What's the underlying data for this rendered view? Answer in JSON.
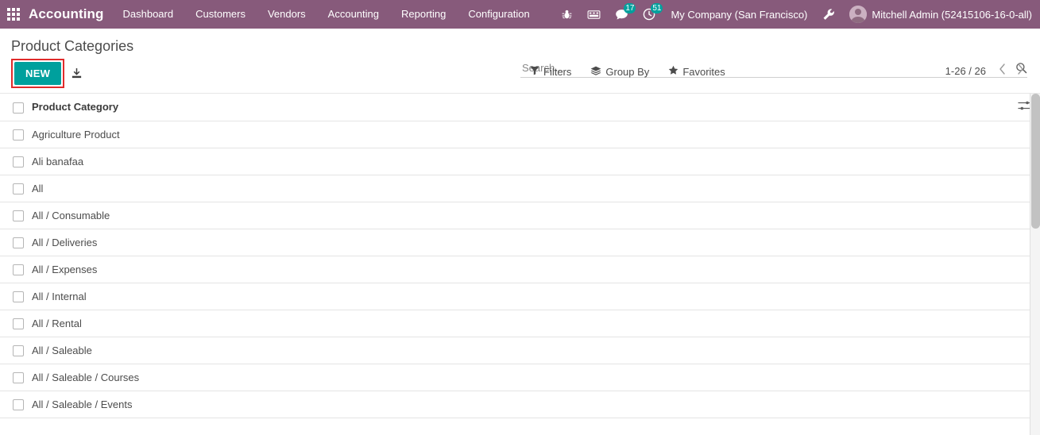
{
  "navbar": {
    "apps_icon": "apps-grid-icon",
    "brand": "Accounting",
    "menu": [
      {
        "label": "Dashboard"
      },
      {
        "label": "Customers"
      },
      {
        "label": "Vendors"
      },
      {
        "label": "Accounting"
      },
      {
        "label": "Reporting"
      },
      {
        "label": "Configuration"
      }
    ],
    "icons": [
      {
        "name": "bug-icon",
        "badge": ""
      },
      {
        "name": "phone-icon",
        "badge": ""
      },
      {
        "name": "messages-icon",
        "badge": "17"
      },
      {
        "name": "activities-clock-icon",
        "badge": "51"
      }
    ],
    "company": "My Company (San Francisco)",
    "debug_icon": "wrench-icon",
    "user": "Mitchell Admin (52415106-16-0-all)"
  },
  "control_panel": {
    "breadcrumb": "Product Categories",
    "new_button": "NEW",
    "upload_icon": "import-records-icon",
    "search": {
      "placeholder": "Search...",
      "value": "",
      "icon": "search-icon"
    },
    "filters": [
      {
        "label": "Filters",
        "icon": "filter-funnel-icon"
      },
      {
        "label": "Group By",
        "icon": "group-by-layers-icon"
      },
      {
        "label": "Favorites",
        "icon": "star-icon"
      }
    ],
    "pager": {
      "range": "1-26 / 26",
      "prev_icon": "chevron-left-icon",
      "next_icon": "chevron-right-icon"
    }
  },
  "list": {
    "columns": [
      "Product Category"
    ],
    "optional_columns_icon": "column-settings-icon",
    "rows": [
      {
        "name": "Agriculture Product"
      },
      {
        "name": "Ali banafaa"
      },
      {
        "name": "All"
      },
      {
        "name": "All / Consumable"
      },
      {
        "name": "All / Deliveries"
      },
      {
        "name": "All / Expenses"
      },
      {
        "name": "All / Internal"
      },
      {
        "name": "All / Rental"
      },
      {
        "name": "All / Saleable"
      },
      {
        "name": "All / Saleable / Courses"
      },
      {
        "name": "All / Saleable / Events"
      }
    ]
  },
  "colors": {
    "brand_purple": "#875A7B",
    "accent_teal": "#00A09D",
    "highlight_red": "#e02b2b"
  }
}
